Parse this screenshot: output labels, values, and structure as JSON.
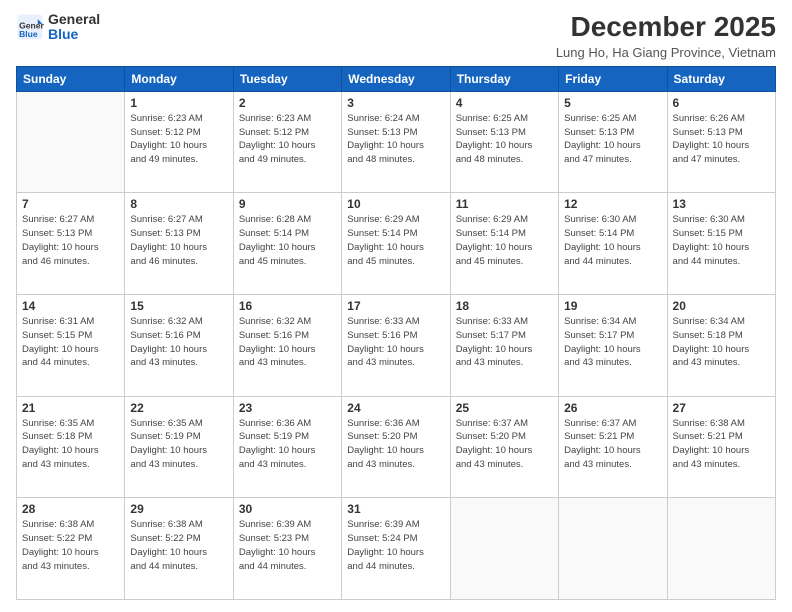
{
  "header": {
    "logo_line1": "General",
    "logo_line2": "Blue",
    "main_title": "December 2025",
    "subtitle": "Lung Ho, Ha Giang Province, Vietnam"
  },
  "days_of_week": [
    "Sunday",
    "Monday",
    "Tuesday",
    "Wednesday",
    "Thursday",
    "Friday",
    "Saturday"
  ],
  "weeks": [
    [
      {
        "num": "",
        "info": ""
      },
      {
        "num": "1",
        "info": "Sunrise: 6:23 AM\nSunset: 5:12 PM\nDaylight: 10 hours\nand 49 minutes."
      },
      {
        "num": "2",
        "info": "Sunrise: 6:23 AM\nSunset: 5:12 PM\nDaylight: 10 hours\nand 49 minutes."
      },
      {
        "num": "3",
        "info": "Sunrise: 6:24 AM\nSunset: 5:13 PM\nDaylight: 10 hours\nand 48 minutes."
      },
      {
        "num": "4",
        "info": "Sunrise: 6:25 AM\nSunset: 5:13 PM\nDaylight: 10 hours\nand 48 minutes."
      },
      {
        "num": "5",
        "info": "Sunrise: 6:25 AM\nSunset: 5:13 PM\nDaylight: 10 hours\nand 47 minutes."
      },
      {
        "num": "6",
        "info": "Sunrise: 6:26 AM\nSunset: 5:13 PM\nDaylight: 10 hours\nand 47 minutes."
      }
    ],
    [
      {
        "num": "7",
        "info": "Sunrise: 6:27 AM\nSunset: 5:13 PM\nDaylight: 10 hours\nand 46 minutes."
      },
      {
        "num": "8",
        "info": "Sunrise: 6:27 AM\nSunset: 5:13 PM\nDaylight: 10 hours\nand 46 minutes."
      },
      {
        "num": "9",
        "info": "Sunrise: 6:28 AM\nSunset: 5:14 PM\nDaylight: 10 hours\nand 45 minutes."
      },
      {
        "num": "10",
        "info": "Sunrise: 6:29 AM\nSunset: 5:14 PM\nDaylight: 10 hours\nand 45 minutes."
      },
      {
        "num": "11",
        "info": "Sunrise: 6:29 AM\nSunset: 5:14 PM\nDaylight: 10 hours\nand 45 minutes."
      },
      {
        "num": "12",
        "info": "Sunrise: 6:30 AM\nSunset: 5:14 PM\nDaylight: 10 hours\nand 44 minutes."
      },
      {
        "num": "13",
        "info": "Sunrise: 6:30 AM\nSunset: 5:15 PM\nDaylight: 10 hours\nand 44 minutes."
      }
    ],
    [
      {
        "num": "14",
        "info": "Sunrise: 6:31 AM\nSunset: 5:15 PM\nDaylight: 10 hours\nand 44 minutes."
      },
      {
        "num": "15",
        "info": "Sunrise: 6:32 AM\nSunset: 5:16 PM\nDaylight: 10 hours\nand 43 minutes."
      },
      {
        "num": "16",
        "info": "Sunrise: 6:32 AM\nSunset: 5:16 PM\nDaylight: 10 hours\nand 43 minutes."
      },
      {
        "num": "17",
        "info": "Sunrise: 6:33 AM\nSunset: 5:16 PM\nDaylight: 10 hours\nand 43 minutes."
      },
      {
        "num": "18",
        "info": "Sunrise: 6:33 AM\nSunset: 5:17 PM\nDaylight: 10 hours\nand 43 minutes."
      },
      {
        "num": "19",
        "info": "Sunrise: 6:34 AM\nSunset: 5:17 PM\nDaylight: 10 hours\nand 43 minutes."
      },
      {
        "num": "20",
        "info": "Sunrise: 6:34 AM\nSunset: 5:18 PM\nDaylight: 10 hours\nand 43 minutes."
      }
    ],
    [
      {
        "num": "21",
        "info": "Sunrise: 6:35 AM\nSunset: 5:18 PM\nDaylight: 10 hours\nand 43 minutes."
      },
      {
        "num": "22",
        "info": "Sunrise: 6:35 AM\nSunset: 5:19 PM\nDaylight: 10 hours\nand 43 minutes."
      },
      {
        "num": "23",
        "info": "Sunrise: 6:36 AM\nSunset: 5:19 PM\nDaylight: 10 hours\nand 43 minutes."
      },
      {
        "num": "24",
        "info": "Sunrise: 6:36 AM\nSunset: 5:20 PM\nDaylight: 10 hours\nand 43 minutes."
      },
      {
        "num": "25",
        "info": "Sunrise: 6:37 AM\nSunset: 5:20 PM\nDaylight: 10 hours\nand 43 minutes."
      },
      {
        "num": "26",
        "info": "Sunrise: 6:37 AM\nSunset: 5:21 PM\nDaylight: 10 hours\nand 43 minutes."
      },
      {
        "num": "27",
        "info": "Sunrise: 6:38 AM\nSunset: 5:21 PM\nDaylight: 10 hours\nand 43 minutes."
      }
    ],
    [
      {
        "num": "28",
        "info": "Sunrise: 6:38 AM\nSunset: 5:22 PM\nDaylight: 10 hours\nand 43 minutes."
      },
      {
        "num": "29",
        "info": "Sunrise: 6:38 AM\nSunset: 5:22 PM\nDaylight: 10 hours\nand 44 minutes."
      },
      {
        "num": "30",
        "info": "Sunrise: 6:39 AM\nSunset: 5:23 PM\nDaylight: 10 hours\nand 44 minutes."
      },
      {
        "num": "31",
        "info": "Sunrise: 6:39 AM\nSunset: 5:24 PM\nDaylight: 10 hours\nand 44 minutes."
      },
      {
        "num": "",
        "info": ""
      },
      {
        "num": "",
        "info": ""
      },
      {
        "num": "",
        "info": ""
      }
    ]
  ]
}
